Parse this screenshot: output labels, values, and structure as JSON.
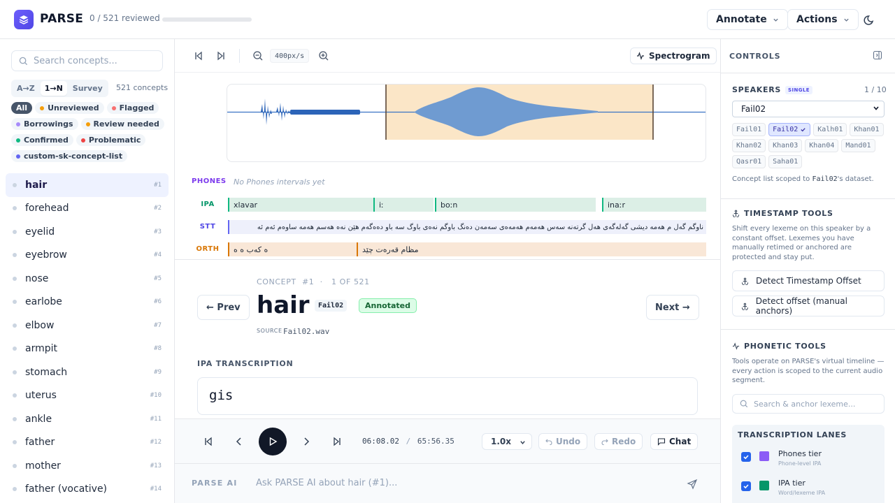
{
  "header": {
    "brand": "PARSE",
    "reviewed": "0 / 521 reviewed",
    "progress_fraction": 0.0,
    "annotate_label": "Annotate",
    "actions_label": "Actions"
  },
  "sidebar": {
    "search_placeholder": "Search concepts...",
    "sort_options": [
      "A→Z",
      "1→N",
      "Survey"
    ],
    "sort_selected": "1→N",
    "concept_count": "521 concepts",
    "filters": [
      {
        "label": "All",
        "color": "#475569"
      },
      {
        "label": "Unreviewed",
        "color": "#f59e0b"
      },
      {
        "label": "Flagged",
        "color": "#f87171"
      },
      {
        "label": "Borrowings",
        "color": "#a78bfa"
      },
      {
        "label": "Review needed",
        "color": "#f59e0b"
      },
      {
        "label": "Confirmed",
        "color": "#10b981"
      },
      {
        "label": "Problematic",
        "color": "#ef4444"
      },
      {
        "label": "custom-sk-concept-list",
        "color": "#6366f1"
      }
    ],
    "concepts": [
      {
        "name": "hair",
        "num": "#1"
      },
      {
        "name": "forehead",
        "num": "#2"
      },
      {
        "name": "eyelid",
        "num": "#3"
      },
      {
        "name": "eyebrow",
        "num": "#4"
      },
      {
        "name": "nose",
        "num": "#5"
      },
      {
        "name": "earlobe",
        "num": "#6"
      },
      {
        "name": "elbow",
        "num": "#7"
      },
      {
        "name": "armpit",
        "num": "#8"
      },
      {
        "name": "stomach",
        "num": "#9"
      },
      {
        "name": "uterus",
        "num": "#10"
      },
      {
        "name": "ankle",
        "num": "#11"
      },
      {
        "name": "father",
        "num": "#12"
      },
      {
        "name": "mother",
        "num": "#13"
      },
      {
        "name": "father (vocative)",
        "num": "#14"
      }
    ]
  },
  "waveform_toolbar": {
    "zoom": "400px/s",
    "spectrogram_label": "Spectrogram"
  },
  "tiers": {
    "phones": {
      "label": "PHONES",
      "empty_text": "No Phones intervals yet"
    },
    "ipa": {
      "label": "IPA",
      "segments": [
        "xlavar",
        "iː",
        "boːn",
        "inaːr"
      ]
    },
    "stt": {
      "label": "STT",
      "text": "ناوگم گەل م هەمە دیشی گەلەگەی هەل گرتەنە سەس هەمەم هەمەەی سەمەن دەنگ باوگم نەەی باوگ سە باو دەەگەم هێن نەە هەسم هەمە ساوەم ئەم ئە"
    },
    "orth": {
      "label": "ORTH",
      "segments": [
        "ه کەب ە ە",
        "مظام قەرەت چێد"
      ]
    }
  },
  "concept": {
    "label": "CONCEPT",
    "id": "#1",
    "position": "1 OF 521",
    "title": "hair",
    "speaker": "Fail02",
    "status": "Annotated",
    "source_label": "SOURCE",
    "source": "Fail02.wav",
    "prev_label": "← Prev",
    "next_label": "Next →",
    "ipa_heading": "IPA TRANSCRIPTION",
    "ipa_value": "gis"
  },
  "player": {
    "current": "06:08.02",
    "separator": "/",
    "total": "65:56.35",
    "speed": "1.0x",
    "undo": "Undo",
    "redo": "Redo",
    "chat": "Chat"
  },
  "ai": {
    "label": "PARSE AI",
    "placeholder": "Ask PARSE AI about hair (#1)..."
  },
  "controls": {
    "title": "CONTROLS",
    "speakers_title": "SPEAKERS",
    "single_badge": "SINGLE",
    "speaker_count": "1 / 10",
    "selected_speaker": "Fail02",
    "speakers": [
      "Fail01",
      "Fail02",
      "Kalh01",
      "Khan01",
      "Khan02",
      "Khan03",
      "Khan04",
      "Mand01",
      "Qasr01",
      "Saha01"
    ],
    "scope_note_prefix": "Concept list scoped to ",
    "scope_note_speaker": "Fail02",
    "scope_note_suffix": "'s dataset.",
    "timestamp_title": "TIMESTAMP TOOLS",
    "timestamp_note": "Shift every lexeme on this speaker by a constant offset. Lexemes you have manually retimed or anchored are protected and stay put.",
    "detect_offset": "Detect Timestamp Offset",
    "detect_manual": "Detect offset (manual anchors)",
    "phonetic_title": "PHONETIC TOOLS",
    "phonetic_note": "Tools operate on PARSE's virtual timeline — every action is scoped to the current audio segment.",
    "search_anchor_placeholder": "Search & anchor lexeme...",
    "lanes_title": "TRANSCRIPTION LANES",
    "lanes": [
      {
        "name": "Phones tier",
        "sub": "Phone-level IPA",
        "color": "#8b5cf6"
      },
      {
        "name": "IPA tier",
        "sub": "Word/lexeme IPA",
        "color": "#059669"
      }
    ]
  }
}
